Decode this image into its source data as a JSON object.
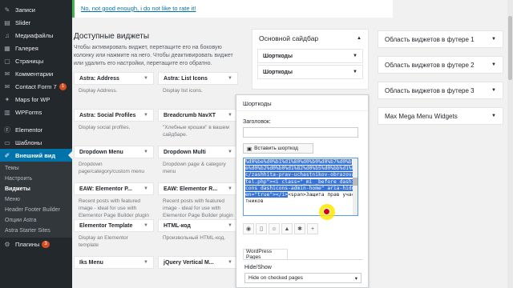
{
  "admin_menu": {
    "items": [
      {
        "label": "Записи",
        "icon": "pin-icon"
      },
      {
        "label": "Slider",
        "icon": "slides-icon"
      },
      {
        "label": "Медиафайлы",
        "icon": "media-icon"
      },
      {
        "label": "Галерея",
        "icon": "gallery-icon"
      },
      {
        "label": "Страницы",
        "icon": "pages-icon"
      },
      {
        "label": "Комментарии",
        "icon": "comments-icon"
      },
      {
        "label": "Contact Form 7",
        "icon": "envelope-icon",
        "badge": "1"
      },
      {
        "label": "Maps for WP",
        "icon": "map-icon"
      },
      {
        "label": "WPForms",
        "icon": "forms-icon"
      },
      {
        "label": "Elementor",
        "icon": "elementor-icon"
      },
      {
        "label": "Шаблоны",
        "icon": "folder-icon"
      },
      {
        "label": "Внешний вид",
        "icon": "brush-icon"
      }
    ],
    "submenu": [
      "Темы",
      "Настроить",
      "Виджеты",
      "Меню",
      "Header Footer Builder",
      "Опции Astra",
      "Astra Starter Sites"
    ],
    "current_sub": "Виджеты",
    "bottom_item": "Плагины",
    "bottom_badge": "3"
  },
  "notice": {
    "link": "No, not good enough, i do not like to rate it!"
  },
  "available": {
    "heading": "Доступные виджеты",
    "description": "Чтобы активировать виджет, перетащите его на боковую колонку или нажмите на него. Чтобы деактивировать виджет или удалить его настройки, перетащите его обратно.",
    "widgets": [
      {
        "title": "Astra: Address",
        "desc": "Display Address."
      },
      {
        "title": "Astra: List Icons",
        "desc": "Display list icons."
      },
      {
        "title": "Astra: Social Profiles",
        "desc": "Display social profiles."
      },
      {
        "title": "Breadcrumb NavXT",
        "desc": "\"Хлебные крошки\" в вашем сайдбаре."
      },
      {
        "title": "Dropdown Menu",
        "desc": "Dropdown page/category/custom menu"
      },
      {
        "title": "Dropdown Multi",
        "desc": "Dropdown page & category menu"
      },
      {
        "title": "EAW: Elementor P...",
        "desc": "Recent posts with featured image - ideal for use with Elementor Page Builder plugin"
      },
      {
        "title": "EAW: Elementor R...",
        "desc": "Recent posts with featured image - ideal for use with Elementor Page Builder plugin"
      },
      {
        "title": "Elementor Template",
        "desc": "Display an Elementor template"
      },
      {
        "title": "HTML-код",
        "desc": "Произвольный HTML-код."
      },
      {
        "title": "Iks Menu",
        "desc": ""
      },
      {
        "title": "jQuery Vertical M...",
        "desc": ""
      }
    ]
  },
  "main_sidebar": {
    "title": "Основной сайдбар",
    "widgets": [
      "Шорткоды",
      "Шорткоды"
    ]
  },
  "right_areas": [
    "Область виджетов в футере 1",
    "Область виджетов в футере 2",
    "Область виджетов в футере 3",
    "Max Mega Menu Widgets"
  ],
  "open_widget": {
    "title": "Шорткоды",
    "field_label": "Заголовок:",
    "insert_button": "Вставить шорткод",
    "code_selected": "%d0%be%d0%b1%d1%80%d0%b0%d0%b7%d0%be%d0%b2%d0%b0%d1%82%d0%b5%d0%bb%d1%8c/zashhita-prav-uchastnikov-obrazovatel.php\"><i class=\"_mi _before dashicons dashicons-admin-home\" aria-hidden=\"true\"></i>",
    "code_rest": "<span>Защита прав участников",
    "tab_label": "WordPress Pages",
    "hide_label": "Hide/Show",
    "hide_value": "Hide on checked pages"
  },
  "caret": "▼"
}
